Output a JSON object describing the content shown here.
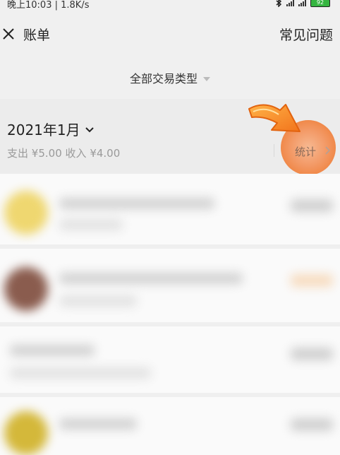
{
  "status_bar": {
    "time_text": "晚上10:03 | 1.8K/s",
    "battery_level": "92"
  },
  "header": {
    "title": "账单",
    "faq_label": "常见问题"
  },
  "filter": {
    "label": "全部交易类型"
  },
  "month_panel": {
    "month_label": "2021年1月",
    "expense_label": "支出",
    "expense_amount": "¥5.00",
    "income_label": "收入",
    "income_amount": "¥4.00",
    "stats_label": "统计"
  },
  "transactions": [
    {
      "avatar_color": "#efd770",
      "blurred": true
    },
    {
      "avatar_color": "#8a5c4e",
      "blurred": true,
      "amount_color": "#f7dcc0"
    },
    {
      "avatar_color": null,
      "blurred": true
    },
    {
      "avatar_color": "#d4b83a",
      "blurred": true
    }
  ],
  "colors": {
    "accent_highlight": "#f08848",
    "arrow": "#f7931e"
  },
  "icons": [
    "close-icon",
    "chevron-down-icon",
    "chevron-right-icon",
    "pointer-arrow-icon",
    "bluetooth-icon",
    "signal-icon",
    "battery-icon"
  ]
}
